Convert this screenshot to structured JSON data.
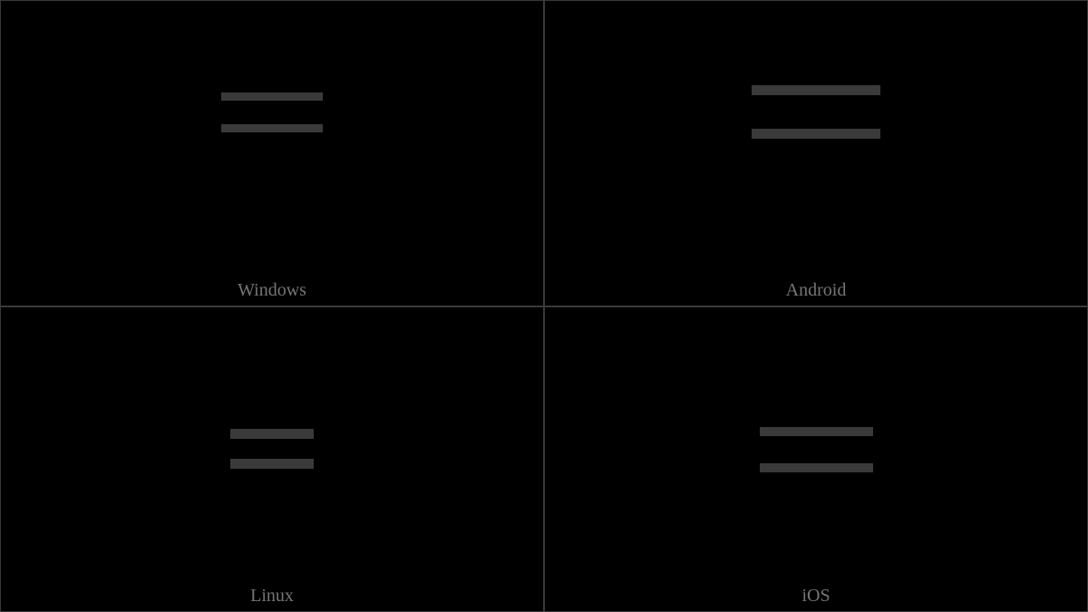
{
  "cells": {
    "windows": {
      "label": "Windows"
    },
    "android": {
      "label": "Android"
    },
    "linux": {
      "label": "Linux"
    },
    "ios": {
      "label": "iOS"
    }
  },
  "glyph": {
    "description": "equals-sign",
    "bar_color": "#3a3a3a"
  }
}
